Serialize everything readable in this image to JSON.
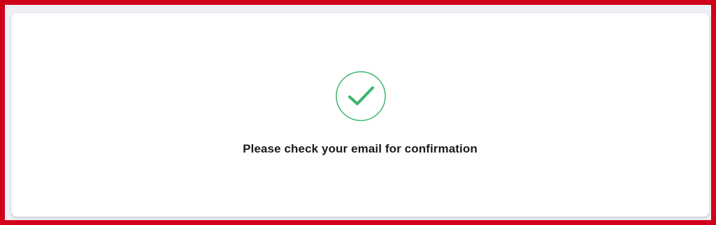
{
  "confirmation": {
    "icon": "check-circle-icon",
    "message": "Please check your email for confirmation"
  },
  "colors": {
    "frame_border": "#d0021b",
    "success_green": "#3cb46e",
    "text": "#1a1a1a",
    "card_background": "#ffffff"
  }
}
